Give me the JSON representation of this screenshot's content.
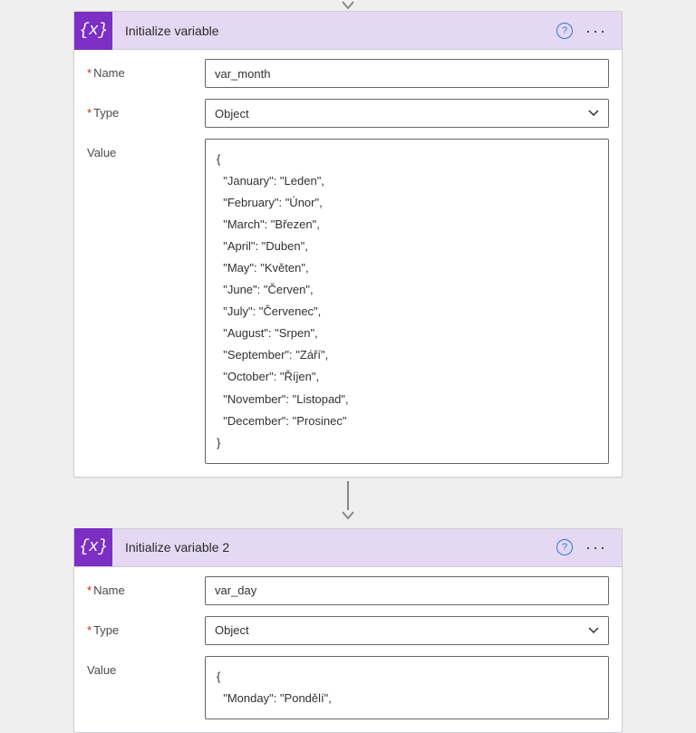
{
  "card1": {
    "title": "Initialize variable",
    "nameLabel": "Name",
    "nameValue": "var_month",
    "typeLabel": "Type",
    "typeValue": "Object",
    "valueLabel": "Value",
    "valueText": "{\n  \"January\": \"Leden\",\n  \"February\": \"Únor\",\n  \"March\": \"Březen\",\n  \"April\": \"Duben\",\n  \"May\": \"Květen\",\n  \"June\": \"Červen\",\n  \"July\": \"Červenec\",\n  \"August\": \"Srpen\",\n  \"September\": \"Září\",\n  \"October\": \"Říjen\",\n  \"November\": \"Listopad\",\n  \"December\": \"Prosinec\"\n}"
  },
  "card2": {
    "title": "Initialize variable 2",
    "nameLabel": "Name",
    "nameValue": "var_day",
    "typeLabel": "Type",
    "typeValue": "Object",
    "valueLabel": "Value",
    "valueText": "{\n  \"Monday\": \"Pondělí\","
  },
  "glyphs": {
    "help": "?",
    "more": "···",
    "variable": "{x}"
  }
}
